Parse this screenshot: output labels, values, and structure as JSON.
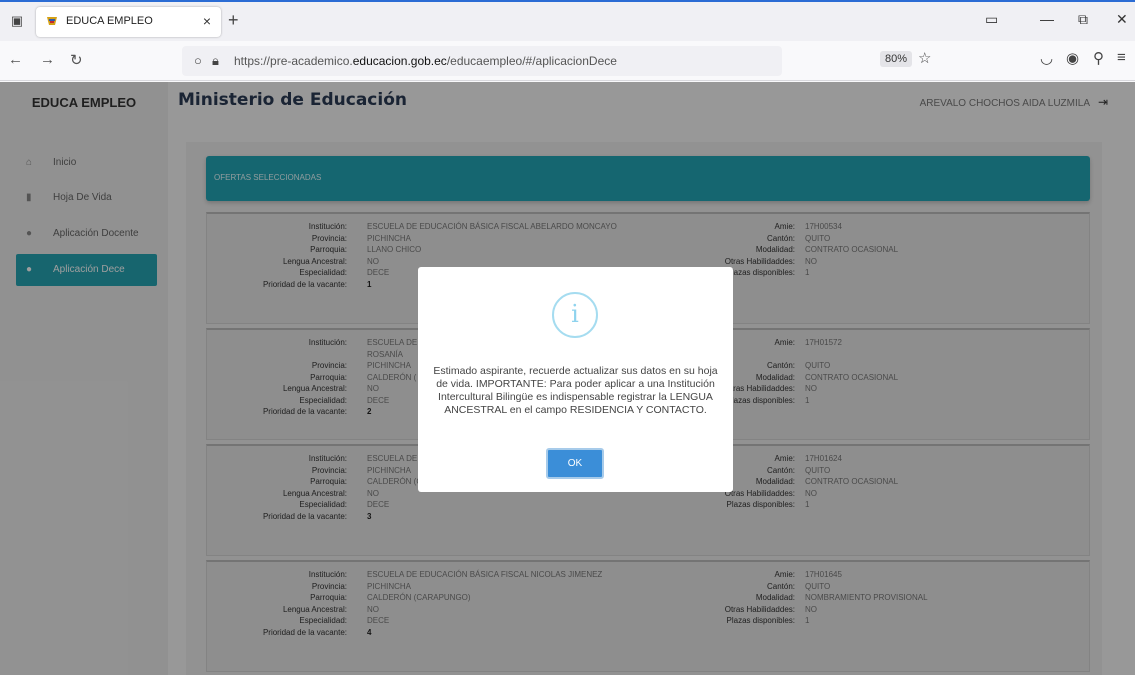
{
  "browser": {
    "tab_title": "EDUCA EMPLEO",
    "url_prefix": "https://pre-academico.",
    "url_domain": "educacion.gob.ec",
    "url_path": "/educaempleo/#/aplicacionDece",
    "zoom": "80%"
  },
  "sidebar": {
    "brand": "EDUCA EMPLEO",
    "items": [
      {
        "label": "Inicio",
        "icon": "home-icon"
      },
      {
        "label": "Hoja De Vida",
        "icon": "document-icon"
      },
      {
        "label": "Aplicación Docente",
        "icon": "user-icon"
      },
      {
        "label": "Aplicación Dece",
        "icon": "user-icon",
        "active": true
      }
    ]
  },
  "header": {
    "title": "Ministerio de Educación",
    "user": "AREVALO CHOCHOS AIDA LUZMILA"
  },
  "card": {
    "title": "OFERTAS SELECCIONADAS"
  },
  "labels": {
    "institucion": "Institución:",
    "provincia": "Provincia:",
    "parroquia": "Parroquia:",
    "lengua": "Lengua Ancestral:",
    "especialidad": "Especialidad:",
    "prioridad": "Prioridad de la vacante:",
    "amie": "Amie:",
    "canton": "Cantón:",
    "modalidad": "Modalidad:",
    "habilidades": "Otras Habilidaddes:",
    "plazas": "Plazas disponibles:"
  },
  "offers": [
    {
      "institucion": "ESCUELA DE EDUCACIÓN BÁSICA FISCAL ABELARDO MONCAYO",
      "institucion_2": "",
      "provincia": "PICHINCHA",
      "parroquia": "LLANO CHICO",
      "lengua": "NO",
      "especialidad": "DECE",
      "prioridad": "1",
      "amie": "17H00534",
      "canton": "QUITO",
      "modalidad": "CONTRATO OCASIONAL",
      "habilidades": "NO",
      "plazas": "1"
    },
    {
      "institucion": "ESCUELA DE",
      "institucion_2": "ROSANÍA",
      "provincia": "PICHINCHA",
      "parroquia": "CALDERÓN (",
      "lengua": "NO",
      "especialidad": "DECE",
      "prioridad": "2",
      "amie": "17H01572",
      "canton": "QUITO",
      "modalidad": "CONTRATO OCASIONAL",
      "habilidades": "NO",
      "plazas": "1"
    },
    {
      "institucion": "ESCUELA DE",
      "institucion_2": "",
      "provincia": "PICHINCHA",
      "parroquia": "CALDERÓN (CARAPUNGO)",
      "lengua": "NO",
      "especialidad": "DECE",
      "prioridad": "3",
      "amie": "17H01624",
      "canton": "QUITO",
      "modalidad": "CONTRATO OCASIONAL",
      "habilidades": "NO",
      "plazas": "1"
    },
    {
      "institucion": "ESCUELA DE EDUCACIÓN BÁSICA FISCAL NICOLAS JIMENEZ",
      "institucion_2": "",
      "provincia": "PICHINCHA",
      "parroquia": "CALDERÓN (CARAPUNGO)",
      "lengua": "NO",
      "especialidad": "DECE",
      "prioridad": "4",
      "amie": "17H01645",
      "canton": "QUITO",
      "modalidad": "NOMBRAMIENTO PROVISIONAL",
      "habilidades": "NO",
      "plazas": "1"
    }
  ],
  "modal": {
    "icon": "i",
    "message": "Estimado aspirante, recuerde actualizar sus datos en su hoja de vida. IMPORTANTE: Para poder aplicar a una Institución Intercultural Bilingüe es indispensable registrar la LENGUA ANCESTRAL en el campo RESIDENCIA Y CONTACTO.",
    "ok_label": "OK"
  }
}
